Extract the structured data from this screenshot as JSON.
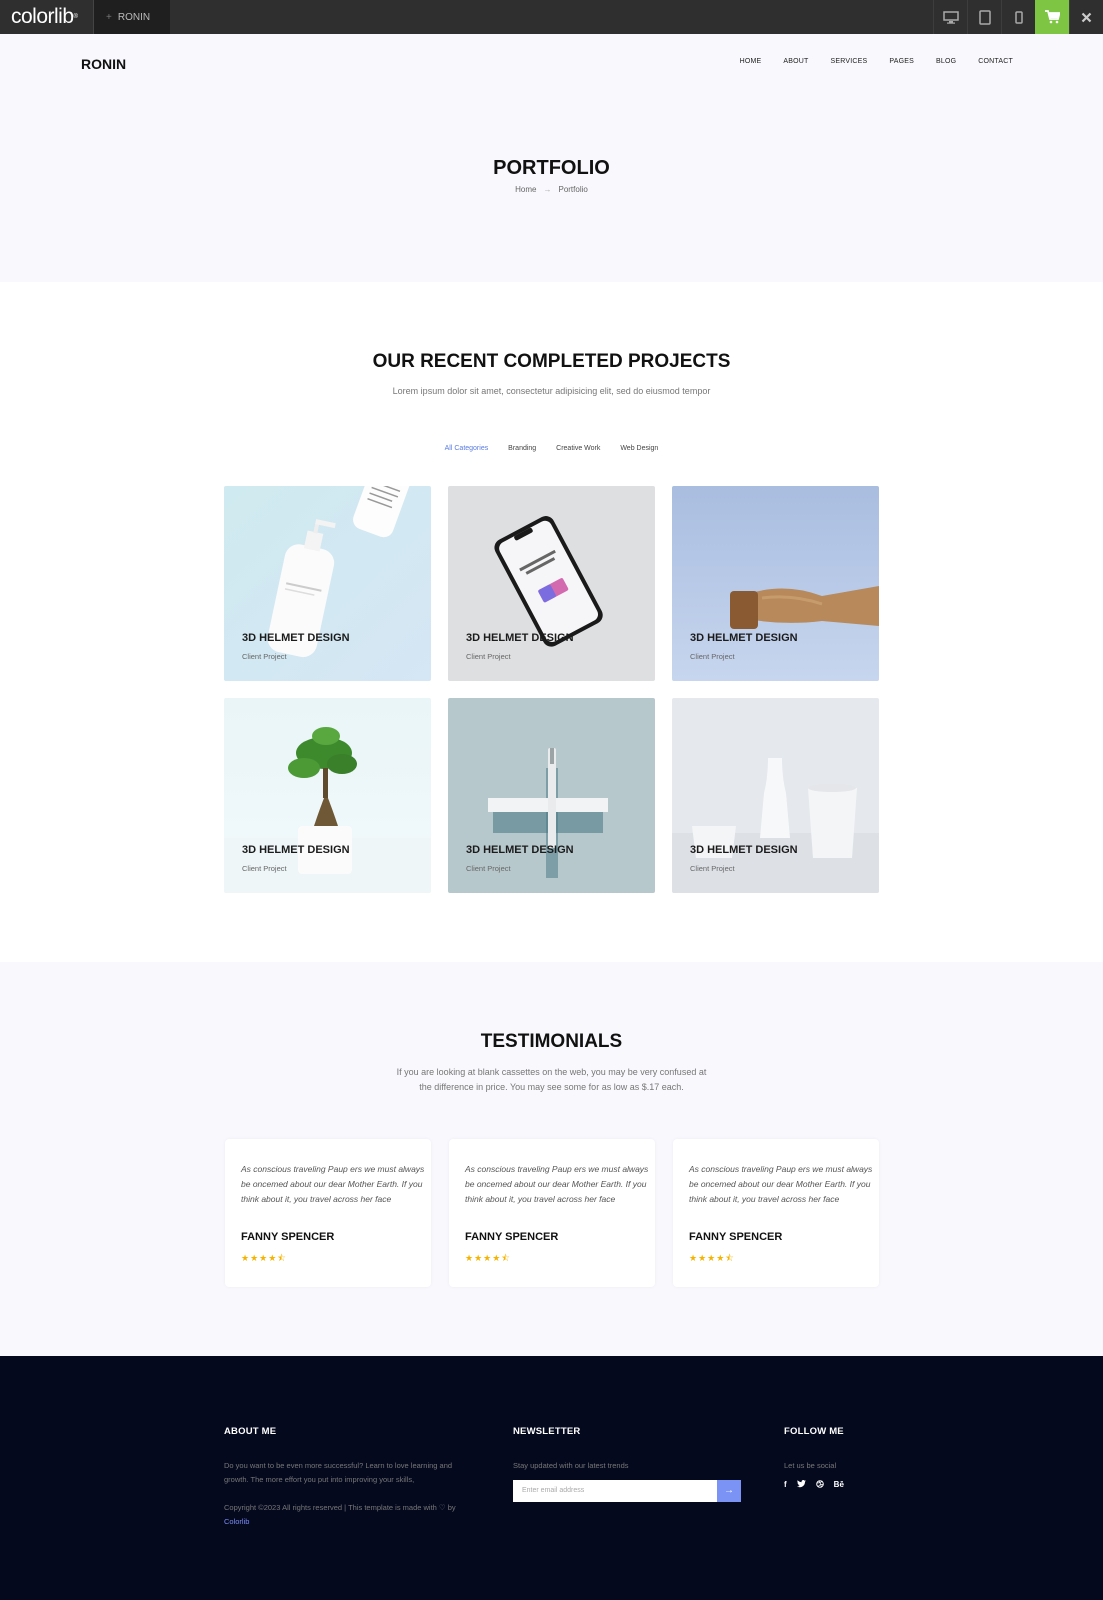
{
  "topbar": {
    "logo": "colorlib",
    "project_tab": "RONIN",
    "icons": [
      "desktop-icon",
      "tablet-icon",
      "mobile-icon",
      "cart-icon",
      "close-icon"
    ],
    "colors": {
      "bar": "#2f2f2f",
      "cart": "#7dc542"
    }
  },
  "header": {
    "brand": "RONIN",
    "nav": [
      "HOME",
      "ABOUT",
      "SERVICES",
      "PAGES",
      "BLOG",
      "CONTACT"
    ],
    "title": "PORTFOLIO",
    "breadcrumb": [
      "Home",
      "Portfolio"
    ]
  },
  "projects": {
    "heading": "OUR RECENT COMPLETED PROJECTS",
    "subheading": "Lorem ipsum dolor sit amet, consectetur adipisicing elit, sed do eiusmod tempor",
    "filters": [
      "All Categories",
      "Branding",
      "Creative Work",
      "Web Design"
    ],
    "active_filter": "All Categories",
    "items": [
      {
        "title": "3D HELMET DESIGN",
        "subtitle": "Client Project",
        "image": "pump-bottle"
      },
      {
        "title": "3D HELMET DESIGN",
        "subtitle": "Client Project",
        "image": "smartphone"
      },
      {
        "title": "3D HELMET DESIGN",
        "subtitle": "Client Project",
        "image": "wooden-stamp"
      },
      {
        "title": "3D HELMET DESIGN",
        "subtitle": "Client Project",
        "image": "bonsai-plant"
      },
      {
        "title": "3D HELMET DESIGN",
        "subtitle": "Client Project",
        "image": "ruler-pen"
      },
      {
        "title": "3D HELMET DESIGN",
        "subtitle": "Client Project",
        "image": "white-ceramics"
      }
    ]
  },
  "testimonials": {
    "heading": "TESTIMONIALS",
    "subheading_line1": "If you are looking at blank cassettes on the web, you may be very confused at",
    "subheading_line2": "the difference in price. You may see some for as low as $.17 each.",
    "items": [
      {
        "quote": "As conscious traveling Paup ers we must always be oncemed about our dear Mother Earth. If you think about it, you travel across her face",
        "name": "FANNY SPENCER",
        "rating": 4.5
      },
      {
        "quote": "As conscious traveling Paup ers we must always be oncemed about our dear Mother Earth. If you think about it, you travel across her face",
        "name": "FANNY SPENCER",
        "rating": 4.5
      },
      {
        "quote": "As conscious traveling Paup ers we must always be oncemed about our dear Mother Earth. If you think about it, you travel across her face",
        "name": "FANNY SPENCER",
        "rating": 4.5
      }
    ],
    "star_color": "#f5b301"
  },
  "footer": {
    "about_heading": "ABOUT ME",
    "about_text_1": "Do you want to be even more successful? Learn to love learning and",
    "about_text_2": "growth. The more effort you put into improving your skills,",
    "copyright": "Copyright ©2023 All rights reserved | This template is made with ♡ by",
    "copyright_link": "Colorlib",
    "newsletter_heading": "NEWSLETTER",
    "newsletter_text": "Stay updated with our latest trends",
    "email_placeholder": "Enter email address",
    "follow_heading": "FOLLOW ME",
    "follow_text": "Let us be social",
    "social": [
      "f",
      "t",
      "d",
      "Bē"
    ],
    "social_icons": [
      "facebook-icon",
      "twitter-icon",
      "dribbble-icon",
      "behance-icon"
    ],
    "accent": "#7a93f5"
  }
}
